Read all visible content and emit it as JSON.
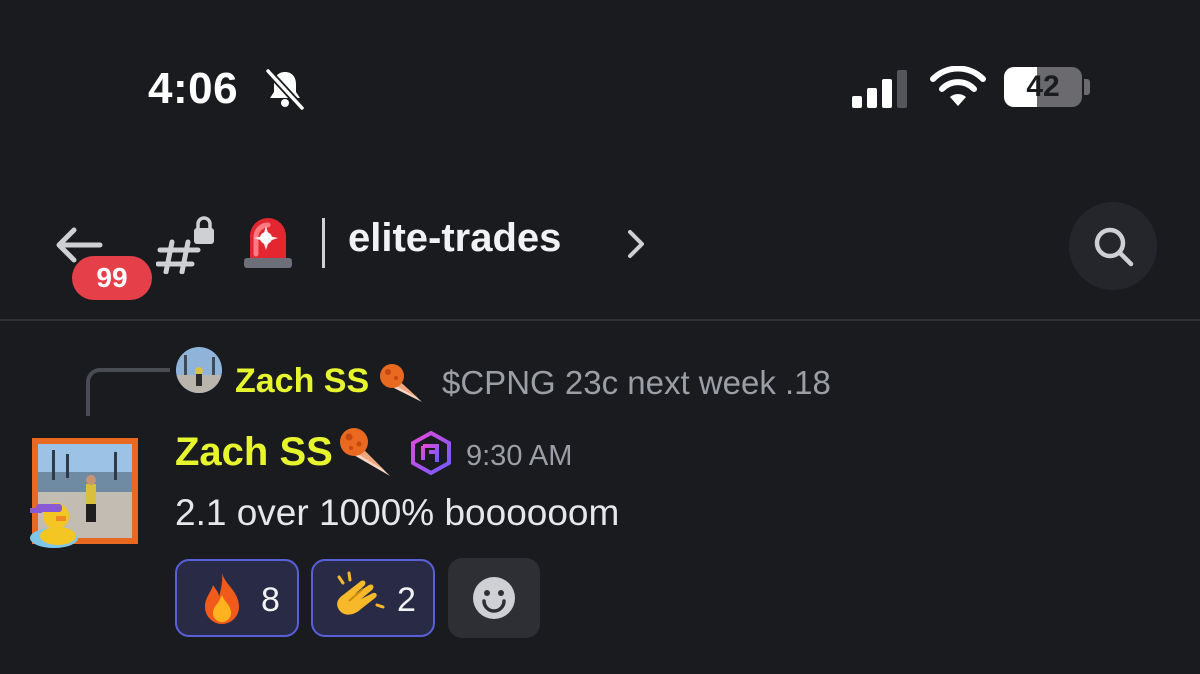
{
  "status_bar": {
    "time": "4:06",
    "battery": "42",
    "battery_fraction": 0.42,
    "icons": [
      "bell-off-icon",
      "cellular-signal-icon",
      "wifi-icon",
      "battery-icon"
    ]
  },
  "header": {
    "unread_count": "99",
    "channel_name": "elite-trades",
    "icons": [
      "back-arrow-icon",
      "locked-text-channel-icon",
      "siren-emoji",
      "chevron-right-icon",
      "search-icon"
    ]
  },
  "reply": {
    "author": "Zach SS",
    "text": "$CPNG 23c next week .18",
    "author_color": "#e7f52e"
  },
  "message": {
    "author": "Zach SS",
    "time": "9:30 AM",
    "text": "2.1 over 1000% boooooom",
    "author_color": "#e7f52e"
  },
  "reactions": [
    {
      "emoji": "fire",
      "count": "8"
    },
    {
      "emoji": "clapping-hands",
      "count": "2"
    }
  ],
  "colors": {
    "background": "#1a1b1f",
    "unread_badge": "#e5404a",
    "reaction_border": "#5860d8",
    "reaction_bg": "#292b46"
  }
}
